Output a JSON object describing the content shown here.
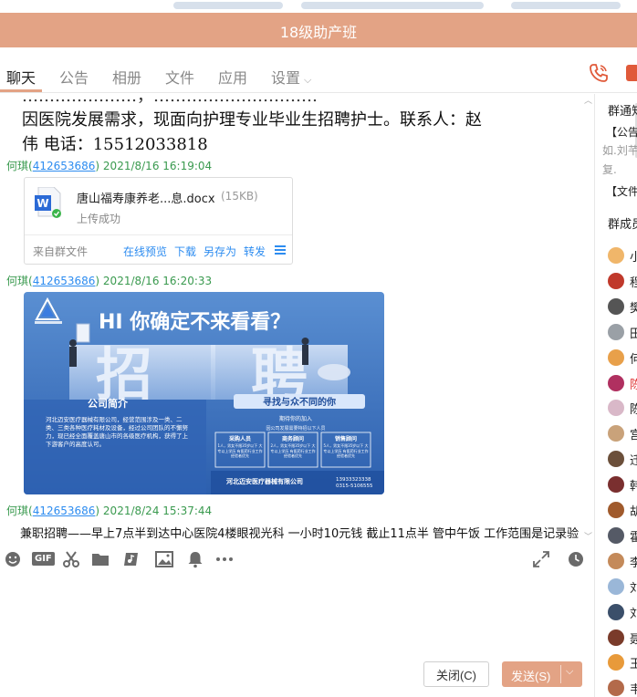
{
  "window": {
    "title": "18级助产班"
  },
  "tabs": [
    {
      "label": "聊天"
    },
    {
      "label": "公告"
    },
    {
      "label": "相册"
    },
    {
      "label": "文件"
    },
    {
      "label": "应用"
    },
    {
      "label": "设置"
    }
  ],
  "messages": {
    "partial_top": "…………………，…………………………",
    "recruit_line1": "因医院发展需求，现面向护理专业毕业生招聘护士。联系人：赵",
    "recruit_line2": "伟        电话：15512033818",
    "msg1_sender": "何琪",
    "msg1_qq": "412653686",
    "msg1_time": "2021/8/16 16:19:04",
    "file": {
      "name": "唐山福寿康养老...息.docx",
      "size": "(15KB)",
      "status": "上传成功",
      "from": "来自群文件",
      "actions": [
        "在线预览",
        "下载",
        "另存为",
        "转发"
      ]
    },
    "msg2_sender": "何琪",
    "msg2_qq": "412653686",
    "msg2_time": "2021/8/16 16:20:33",
    "banner": {
      "headline": "HI 你确定不来看看？",
      "big_char1": "招",
      "big_char2": "聘",
      "company_title": "公司简介",
      "company_desc": "河北迈安医疗器械有限公司，经营范围涉及一类、二类、三类各种医疗耗材及设备，经过公司团队的不懈努力，现已经全面覆盖唐山市的各级医疗机构，获得了上下游客户的高度认可。",
      "slogan": "寻找与众不同的你",
      "join_title": "期待你的加入",
      "join_sub": "因公司发展需要特招以下人员",
      "positions": [
        {
          "title": "采购人员",
          "desc": "1人，男女不限35岁以下 大专以上学历 有医药行业工作经验者优先"
        },
        {
          "title": "商务顾问",
          "desc": "2人，男女不限35岁以下 大专以上学历 有医药行业工作经验者优先"
        },
        {
          "title": "销售顾问",
          "desc": "5人，男女不限35岁以下 大专以上学历 有医药行业工作经验者优先"
        }
      ],
      "company_name": "河北迈安医疗器械有限公司",
      "phone1": "13933323338",
      "phone2": "0315-5106555"
    },
    "msg3_sender": "何琪",
    "msg3_qq": "412653686",
    "msg3_time": "2021/8/24 15:37:44",
    "msg3_text": "兼职招聘——早上7点半到达中心医院4楼眼视光科 一小时10元钱 截止11点半 管中午饭 工作范围是记录验"
  },
  "toolbar": {
    "gif_label": "GIF"
  },
  "buttons": {
    "close": "关闭(C)",
    "send": "发送(S)"
  },
  "sidebar": {
    "title": "群通知",
    "notice": "【公告】",
    "preview1": "如.刘芊",
    "preview2": "复.",
    "files": "【文件】",
    "members_title": "群成员",
    "members": [
      {
        "name": "小",
        "color": "#f0b66a",
        "red": false
      },
      {
        "name": "程",
        "color": "#c0392b",
        "red": false
      },
      {
        "name": "樊",
        "color": "#555555",
        "red": false
      },
      {
        "name": "田",
        "color": "#9aa0a6",
        "red": false
      },
      {
        "name": "何",
        "color": "#e8a04a",
        "red": false
      },
      {
        "name": "陈",
        "color": "#b03060",
        "red": true
      },
      {
        "name": "陈",
        "color": "#d9b8c8",
        "red": false
      },
      {
        "name": "宫",
        "color": "#c9a27a",
        "red": false
      },
      {
        "name": "迁",
        "color": "#6b4f3a",
        "red": false
      },
      {
        "name": "韩",
        "color": "#7a2f2f",
        "red": false
      },
      {
        "name": "胡",
        "color": "#a05a2c",
        "red": false
      },
      {
        "name": "霍",
        "color": "#555a66",
        "red": false
      },
      {
        "name": "李",
        "color": "#c48a5a",
        "red": false
      },
      {
        "name": "刘",
        "color": "#9ab7d8",
        "red": false
      },
      {
        "name": "刘",
        "color": "#3b4f6a",
        "red": false
      },
      {
        "name": "聂",
        "color": "#7a3b2a",
        "red": false
      },
      {
        "name": "王",
        "color": "#e89a3a",
        "red": false
      },
      {
        "name": "韦",
        "color": "#b36a4a",
        "red": false
      }
    ]
  },
  "colors": {
    "accent": "#e3a385",
    "link": "#2d8cf0",
    "meta_green": "#3a9a4f",
    "call_red": "#e05a3a"
  }
}
